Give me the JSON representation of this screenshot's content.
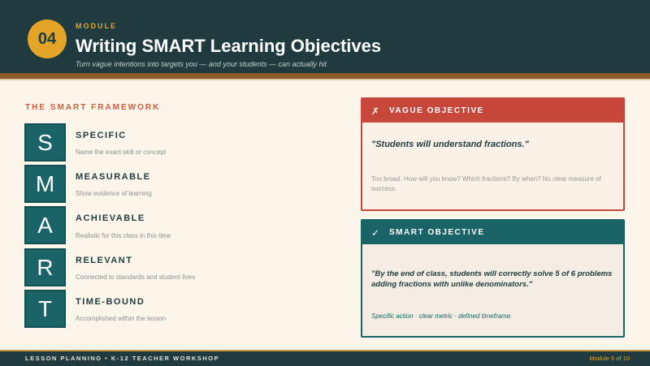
{
  "header": {
    "badge_number": "04",
    "module_label": "MODULE",
    "title": "Writing SMART Learning Objectives",
    "subtitle": "Turn vague intentions into targets you — and your students — can actually hit"
  },
  "framework": {
    "section_title": "THE SMART FRAMEWORK",
    "items": [
      {
        "letter": "S",
        "title": "SPECIFIC",
        "desc": "Name the exact skill or concept"
      },
      {
        "letter": "M",
        "title": "MEASURABLE",
        "desc": "Show evidence of learning"
      },
      {
        "letter": "A",
        "title": "ACHIEVABLE",
        "desc": "Realistic for this class in this time"
      },
      {
        "letter": "R",
        "title": "RELEVANT",
        "desc": "Connected to standards and student lives"
      },
      {
        "letter": "T",
        "title": "TIME-BOUND",
        "desc": "Accomplished within the lesson"
      }
    ]
  },
  "vague_card": {
    "icon": "✗",
    "label": "VAGUE OBJECTIVE",
    "quote": "\"Students will understand fractions.\"",
    "note": "Too broad. How will you know? Which fractions? By when? No clear measure of success."
  },
  "smart_card": {
    "icon": "✓",
    "label": "SMART OBJECTIVE",
    "quote": "\"By the end of class, students will correctly solve 5 of 6 problems adding fractions with unlike denominators.\"",
    "note": "Specific action · clear metric · defined timeframe."
  },
  "footer": {
    "left": "LESSON PLANNING  •  K-12 TEACHER WORKSHOP",
    "right": "Module 5 of 10"
  },
  "colors": {
    "header_bg": "#1f3b40",
    "accent_gold": "#e3a427",
    "teal": "#1a6468",
    "red": "#c7473a",
    "section_orange": "#d25b3c",
    "page_bg": "#fbf5ea"
  }
}
